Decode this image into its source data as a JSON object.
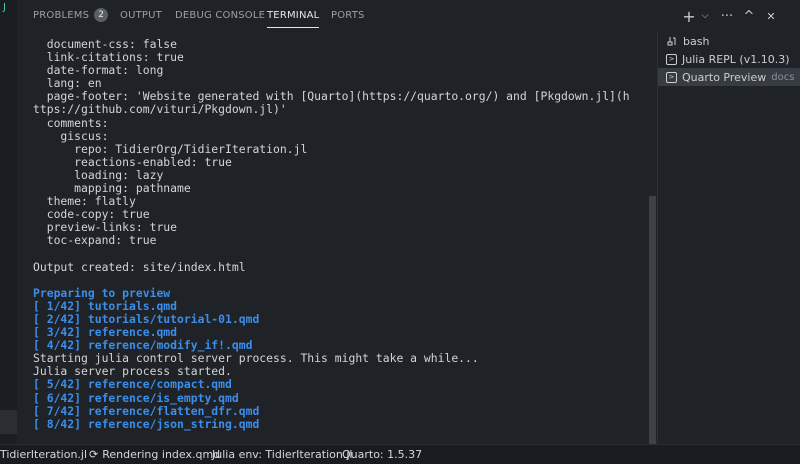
{
  "activity": {
    "glyph": "J"
  },
  "tabs": [
    {
      "label": "PROBLEMS",
      "badge": "2"
    },
    {
      "label": "OUTPUT"
    },
    {
      "label": "DEBUG CONSOLE"
    },
    {
      "label": "TERMINAL",
      "active": true
    },
    {
      "label": "PORTS"
    }
  ],
  "actions": {
    "new_terminal": "+",
    "dropdown": "⌵",
    "more": "···",
    "maximize": "^",
    "close": "✕"
  },
  "terminal": {
    "lines": [
      {
        "text": "  document-css: false"
      },
      {
        "text": "  link-citations: true"
      },
      {
        "text": "  date-format: long"
      },
      {
        "text": "  lang: en"
      },
      {
        "text": "  page-footer: 'Website generated with [Quarto](https://quarto.org/) and [Pkgdown.jl](h"
      },
      {
        "text": "ttps://github.com/vituri/Pkgdown.jl)'"
      },
      {
        "text": "  comments:"
      },
      {
        "text": "    giscus:"
      },
      {
        "text": "      repo: TidierOrg/TidierIteration.jl"
      },
      {
        "text": "      reactions-enabled: true"
      },
      {
        "text": "      loading: lazy"
      },
      {
        "text": "      mapping: pathname"
      },
      {
        "text": "  theme: flatly"
      },
      {
        "text": "  code-copy: true"
      },
      {
        "text": "  preview-links: true"
      },
      {
        "text": "  toc-expand: true"
      },
      {
        "text": ""
      },
      {
        "text": "Output created: site/index.html"
      },
      {
        "text": ""
      },
      {
        "text": "Preparing to preview",
        "hl": true
      },
      {
        "text": "[ 1/42] tutorials.qmd",
        "hl": true
      },
      {
        "text": "[ 2/42] tutorials/tutorial-01.qmd",
        "hl": true
      },
      {
        "text": "[ 3/42] reference.qmd",
        "hl": true
      },
      {
        "text": "[ 4/42] reference/modify_if!.qmd",
        "hl": true
      },
      {
        "text": "Starting julia control server process. This might take a while..."
      },
      {
        "text": "Julia server process started."
      },
      {
        "text": "[ 5/42] reference/compact.qmd",
        "hl": true
      },
      {
        "text": "[ 6/42] reference/is_empty.qmd",
        "hl": true
      },
      {
        "text": "[ 7/42] reference/flatten_dfr.qmd",
        "hl": true
      },
      {
        "text": "[ 8/42] reference/json_string.qmd",
        "hl": true
      }
    ]
  },
  "terminal_list": [
    {
      "label": "bash",
      "icon": "tool-icon",
      "desc": ""
    },
    {
      "label": "Julia REPL (v1.10.3)",
      "icon": "terminal-icon",
      "desc": ""
    },
    {
      "label": "Quarto Preview",
      "icon": "terminal-icon",
      "desc": "docs",
      "selected": true
    }
  ],
  "status": {
    "project": "TidierIteration.jl",
    "rendering": "Rendering index.qmd",
    "julia_env": "Julia env: TidierIteration.jl",
    "quarto": "Quarto: 1.5.37"
  },
  "colors": {
    "background": "#1f2328",
    "highlight_text": "#3b8eea",
    "normal_text": "#d4d4d4"
  }
}
